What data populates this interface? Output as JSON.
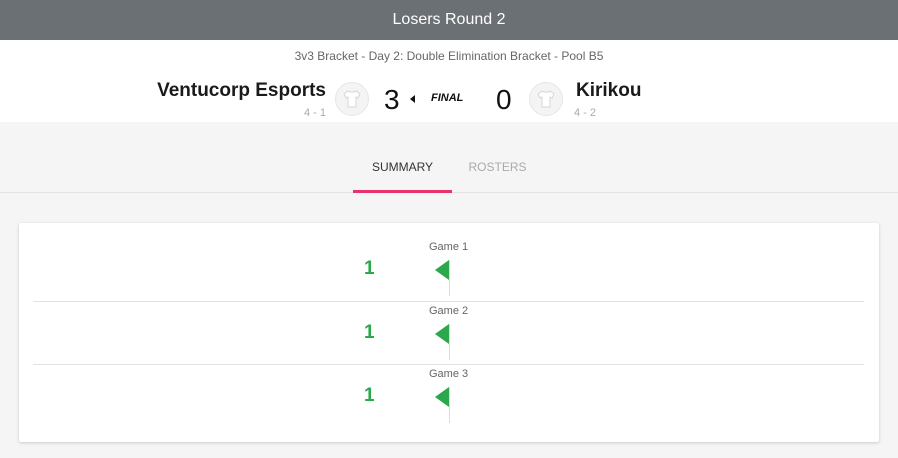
{
  "header": {
    "title": "Losers Round 2"
  },
  "match": {
    "subtitle": "3v3 Bracket - Day 2: Double Elimination Bracket - Pool B5",
    "status": "FINAL",
    "team_left": {
      "name": "Ventucorp Esports",
      "record": "4 - 1",
      "score": "3"
    },
    "team_right": {
      "name": "Kirikou",
      "record": "4 - 2",
      "score": "0"
    }
  },
  "tabs": [
    {
      "label": "SUMMARY",
      "active": true
    },
    {
      "label": "ROSTERS",
      "active": false
    }
  ],
  "games": [
    {
      "label": "Game 1",
      "winner_score": "1"
    },
    {
      "label": "Game 2",
      "winner_score": "1"
    },
    {
      "label": "Game 3",
      "winner_score": "1"
    }
  ],
  "colors": {
    "accent": "#e8336b",
    "win": "#2aa84a",
    "header_bg": "#6b7075"
  },
  "icons": {
    "team_left": "jersey-icon",
    "team_right": "jersey-icon",
    "winner": "winner-caret-icon",
    "game_win": "win-flag-icon"
  }
}
